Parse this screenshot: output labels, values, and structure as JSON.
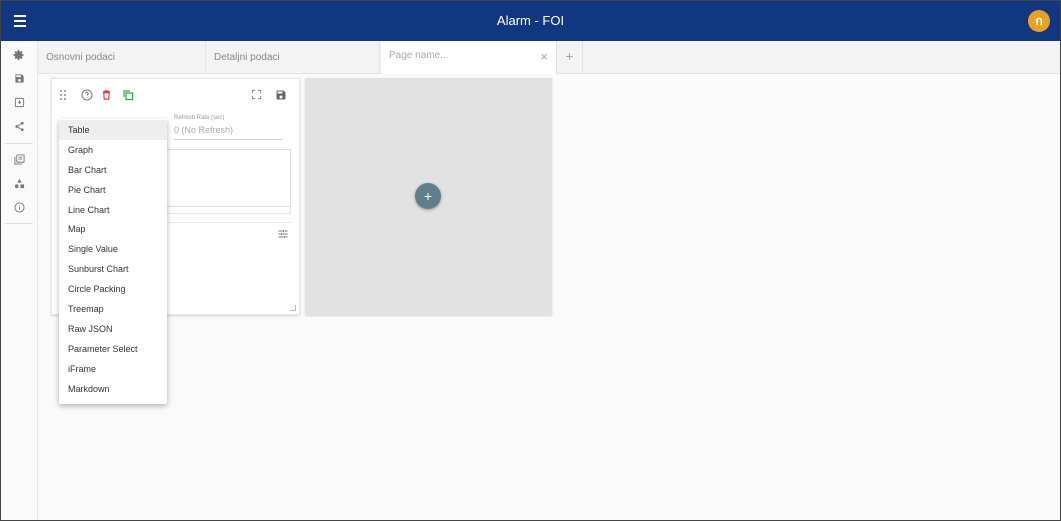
{
  "app": {
    "title": "Alarm - FOI",
    "logo_glyph": "ก"
  },
  "tabs": [
    {
      "label": "Osnovni podaci"
    },
    {
      "label": "Detaljni podaci"
    }
  ],
  "new_tab": {
    "placeholder": "Page name...",
    "close_glyph": "×",
    "add_glyph": "+"
  },
  "rail_icons": [
    "settings-icon",
    "save-icon",
    "import-icon",
    "share-icon",
    "library-icon",
    "shapes-icon",
    "info-icon"
  ],
  "widget": {
    "refresh_label": "Refresh Rate (sec)",
    "refresh_value": "0 (No Refresh)",
    "colors": {
      "delete": "#e53935",
      "copy": "#2eaa3a"
    }
  },
  "add_widget_glyph": "+",
  "chart_type_menu": {
    "selected": "Table",
    "items": [
      "Table",
      "Graph",
      "Bar Chart",
      "Pie Chart",
      "Line Chart",
      "Map",
      "Single Value",
      "Sunburst Chart",
      "Circle Packing",
      "Treemap",
      "Raw JSON",
      "Parameter Select",
      "iFrame",
      "Markdown"
    ]
  },
  "colors": {
    "topbar": "#103782",
    "logo": "#e8a220",
    "add_button": "#5e7f8c"
  }
}
